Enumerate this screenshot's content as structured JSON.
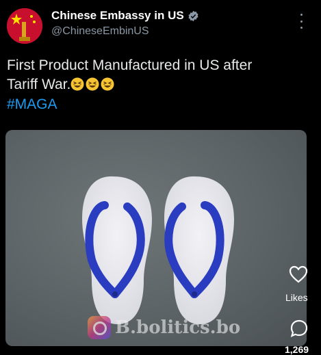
{
  "post": {
    "author_name": "Chinese Embassy in US",
    "handle": "@ChineseEmbinUS",
    "text_line1": "First Product Manufactured in US after",
    "text_line2": "Tariff War.",
    "emojis": [
      "grinning-squinting-face",
      "grinning-squinting-face",
      "grinning-squinting-face"
    ],
    "hashtag": "#MAGA"
  },
  "media": {
    "subject": "flip-flops",
    "watermark_text": "B.bolitics.bo",
    "strap_color": "#2a3cc0",
    "sole_color": "#e9e9ee"
  },
  "actions": {
    "likes_label": "Likes",
    "comments_count": "1,269"
  },
  "colors": {
    "background": "#000000",
    "hashtag": "#1d9bf0",
    "verified": "#8b98a5"
  }
}
